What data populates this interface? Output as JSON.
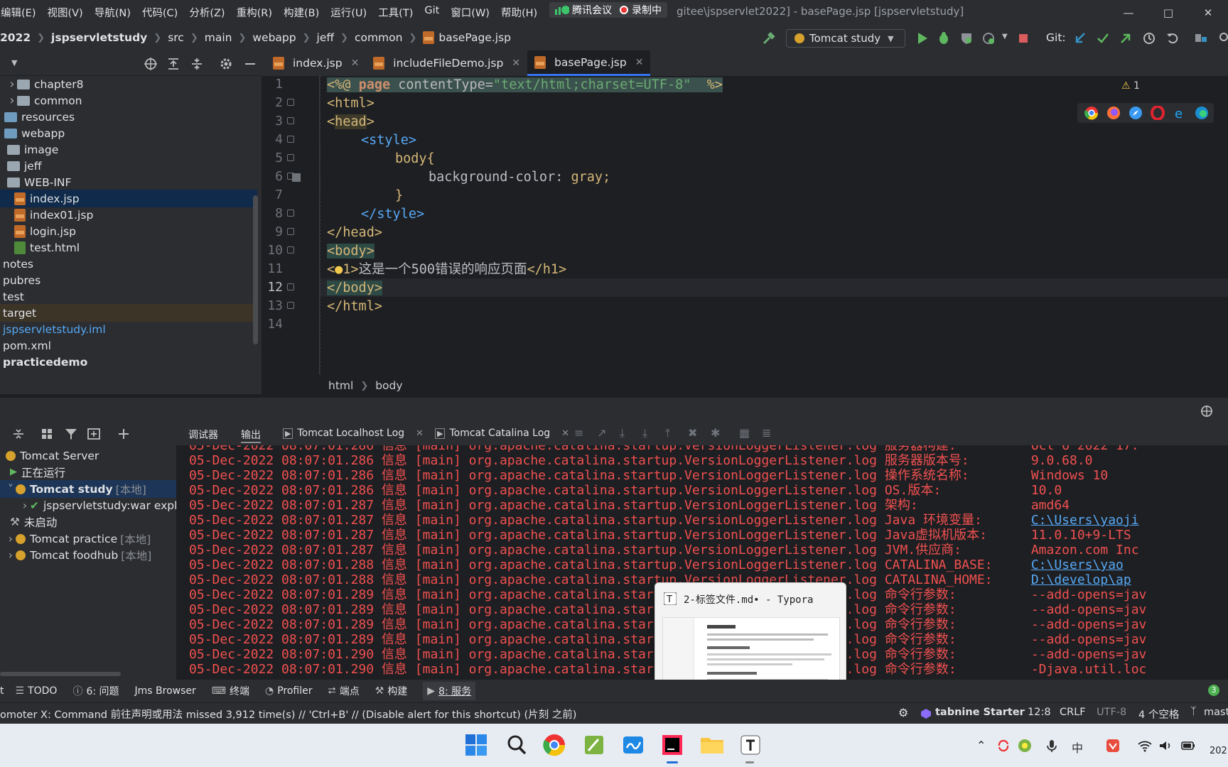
{
  "titlebar": {
    "menus": [
      "编辑(E)",
      "视图(V)",
      "导航(N)",
      "代码(C)",
      "分析(Z)",
      "重构(R)",
      "构建(B)",
      "运行(U)",
      "工具(T)",
      "Git",
      "窗口(W)",
      "帮助(H)"
    ],
    "meeting": "腾讯会议",
    "recording": "录制中",
    "window_title": "gitee\\jspservlet2022] - basePage.jsp [jspservletstudy]"
  },
  "navbar": {
    "crumbs": [
      "2022",
      "jspservletstudy",
      "src",
      "main",
      "webapp",
      "jeff",
      "common",
      "basePage.jsp"
    ],
    "run_config": "Tomcat study",
    "git_label": "Git:"
  },
  "project_tree": [
    {
      "label": "chapter8",
      "type": "folder"
    },
    {
      "label": "common",
      "type": "folder"
    },
    {
      "label": "resources",
      "type": "folder"
    },
    {
      "label": "webapp",
      "type": "folder"
    },
    {
      "label": "image",
      "type": "folder"
    },
    {
      "label": "jeff",
      "type": "folder"
    },
    {
      "label": "WEB-INF",
      "type": "folder"
    },
    {
      "label": "index.jsp",
      "type": "jsp",
      "selected": true
    },
    {
      "label": "index01.jsp",
      "type": "jsp"
    },
    {
      "label": "login.jsp",
      "type": "jsp"
    },
    {
      "label": "test.html",
      "type": "html"
    },
    {
      "label": "notes",
      "type": "folder"
    },
    {
      "label": "pubres",
      "type": "folder"
    },
    {
      "label": "test",
      "type": "folder"
    },
    {
      "label": "target",
      "type": "folder"
    },
    {
      "label": "jspservletstudy.iml",
      "type": "iml"
    },
    {
      "label": "pom.xml",
      "type": "xml"
    },
    {
      "label": "practicedemo",
      "type": "module"
    }
  ],
  "editor": {
    "tabs": [
      "index.jsp",
      "includeFileDemo.jsp",
      "basePage.jsp"
    ],
    "active_tab": "basePage.jsp",
    "line_numbers": [
      "1",
      "2",
      "3",
      "4",
      "5",
      "6",
      "7",
      "8",
      "9",
      "10",
      "11",
      "12",
      "13",
      "14"
    ],
    "warning_count": "1",
    "code": {
      "l1_open": "<%@ ",
      "l1_kw": "page",
      "l1_attr": " contentType=",
      "l1_str": "\"text/html;charset=UTF-8\"",
      "l1_close": "  %>",
      "l2": "html",
      "l3": "head",
      "l4": "style",
      "l5": "body{",
      "l6_prop": "background-color: ",
      "l6_val": "gray;",
      "l7": "}",
      "l8": "style",
      "l9": "head",
      "l10": "body",
      "l11_tag": "1",
      "l11_text": "这是一个500错误的响应页面",
      "l11_close": "h1",
      "l12": "body",
      "l13": "html"
    },
    "breadcrumb": [
      "html",
      "body"
    ]
  },
  "services": {
    "tabs": [
      "调试器",
      "输出",
      "Tomcat Localhost Log",
      "Tomcat Catalina Log"
    ],
    "tree": [
      {
        "label": "Tomcat Server",
        "suffix": ""
      },
      {
        "label": "正在运行",
        "suffix": ""
      },
      {
        "label": "Tomcat study",
        "suffix": "[本地]"
      },
      {
        "label": "jspservletstudy:war expl",
        "suffix": ""
      },
      {
        "label": "未启动",
        "suffix": ""
      },
      {
        "label": "Tomcat practice",
        "suffix": "[本地]"
      },
      {
        "label": "Tomcat foodhub",
        "suffix": "[本地]"
      }
    ],
    "log_prefix_a": "05-Dec-2022 08:07:01.",
    "log_class": " 信息 [main] org.apache.catalina.startup.VersionLoggerListener.log ",
    "log_lines": [
      {
        "ms": "286",
        "key": "服务器构建:",
        "val": "Oct 6 2022 17:"
      },
      {
        "ms": "286",
        "key": "服务器版本号:",
        "val": "9.0.68.0"
      },
      {
        "ms": "286",
        "key": "操作系统名称:",
        "val": "Windows 10"
      },
      {
        "ms": "286",
        "key": "OS.版本:",
        "val": "10.0"
      },
      {
        "ms": "287",
        "key": "架构:",
        "val": "amd64"
      },
      {
        "ms": "287",
        "key": "Java 环境变量:",
        "val": "C:\\Users\\yaoji"
      },
      {
        "ms": "287",
        "key": "Java虚拟机版本:",
        "val": "11.0.10+9-LTS"
      },
      {
        "ms": "287",
        "key": "JVM.供应商:",
        "val": "Amazon.com Inc"
      },
      {
        "ms": "288",
        "key": "CATALINA_BASE:",
        "val": "C:\\Users\\yao"
      },
      {
        "ms": "288",
        "key": "CATALINA_HOME:",
        "val": "D:\\develop\\ap"
      },
      {
        "ms": "289",
        "key": "命令行参数:",
        "val": "--add-opens=jav"
      },
      {
        "ms": "289",
        "key": "命令行参数:",
        "val": "--add-opens=jav"
      },
      {
        "ms": "289",
        "key": "命令行参数:",
        "val": "--add-opens=jav"
      },
      {
        "ms": "289",
        "key": "命令行参数:",
        "val": "--add-opens=jav"
      },
      {
        "ms": "290",
        "key": "命令行参数:",
        "val": "--add-opens=jav"
      },
      {
        "ms": "290",
        "key": "命令行参数:",
        "val": "-Djava.util.loc"
      }
    ]
  },
  "popup": {
    "icon": "T",
    "title": "2-标签文件.md• - Typora"
  },
  "toolwindows": [
    "TODO",
    "6: 问题",
    "Jms Browser",
    "终端",
    "Profiler",
    "端点",
    "构建",
    "8: 服务"
  ],
  "statusbar": {
    "message": "omoter X: Command 前往声明或用法 missed 3,912 time(s) // 'Ctrl+B' // (Disable alert for this shortcut) (片刻 之前)",
    "tabnine": "tabnine Starter",
    "position": "12:8",
    "line_sep": "CRLF",
    "encoding": "UTF-8",
    "indent": "4 个空格",
    "branch": "mast",
    "events": "3"
  },
  "taskbar": {
    "clock_partial": "202"
  },
  "colors": {
    "accent": "#3574f0",
    "log_red": "#f05050",
    "bg": "#1e1f22",
    "panel": "#2b2d30"
  }
}
